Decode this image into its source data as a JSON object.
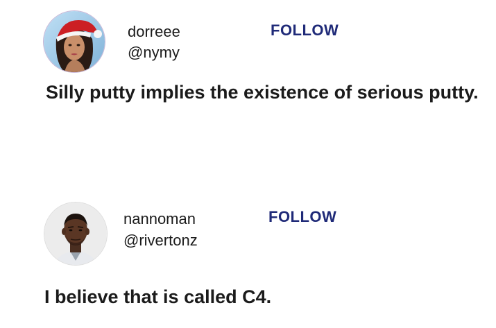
{
  "posts": [
    {
      "display_name": "dorreee",
      "handle": "@nymy",
      "follow_label": "FOLLOW",
      "text": "Silly putty implies the existence of serious putty.",
      "avatar_icon": "user-avatar-santa-hat-icon"
    },
    {
      "display_name": "nannoman",
      "handle": "@rivertonz",
      "follow_label": "FOLLOW",
      "text": "I believe that is called C4.",
      "avatar_icon": "user-avatar-icon"
    }
  ],
  "colors": {
    "follow": "#1f2a78",
    "text": "#1b1b1b",
    "background": "#ffffff"
  }
}
